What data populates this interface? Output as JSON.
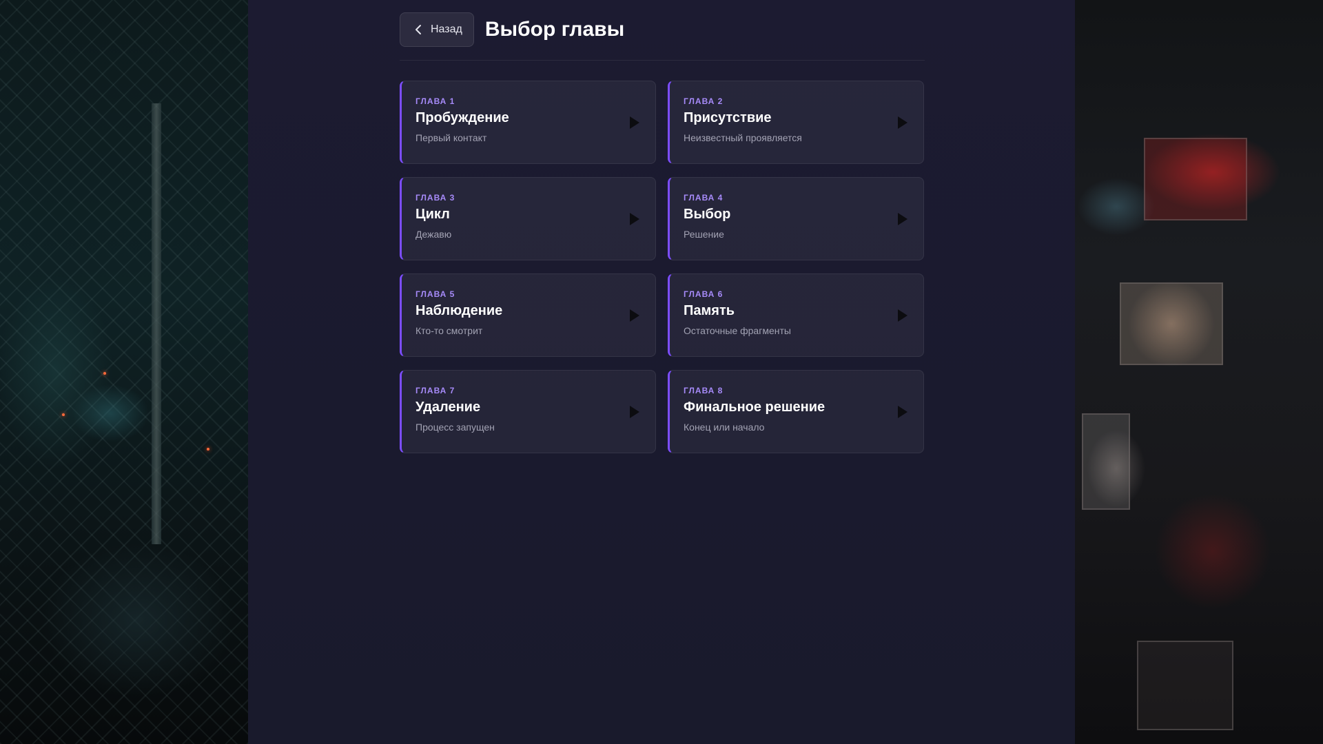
{
  "header": {
    "back_label": "Назад",
    "title": "Выбор главы"
  },
  "chapters": [
    {
      "number": "ГЛАВА 1",
      "title": "Пробуждение",
      "subtitle": "Первый контакт"
    },
    {
      "number": "ГЛАВА 2",
      "title": "Присутствие",
      "subtitle": "Неизвестный проявляется"
    },
    {
      "number": "ГЛАВА 3",
      "title": "Цикл",
      "subtitle": "Дежавю"
    },
    {
      "number": "ГЛАВА 4",
      "title": "Выбор",
      "subtitle": "Решение"
    },
    {
      "number": "ГЛАВА 5",
      "title": "Наблюдение",
      "subtitle": "Кто-то смотрит"
    },
    {
      "number": "ГЛАВА 6",
      "title": "Память",
      "subtitle": "Остаточные фрагменты"
    },
    {
      "number": "ГЛАВА 7",
      "title": "Удаление",
      "subtitle": "Процесс запущен"
    },
    {
      "number": "ГЛАВА 8",
      "title": "Финальное решение",
      "subtitle": "Конец или начало"
    }
  ],
  "icons": {
    "back": "chevron-left-icon",
    "play": "play-icon"
  },
  "colors": {
    "accent": "#7c4dff",
    "chapter_number": "#a78bfa",
    "panel": "#1c1b31"
  }
}
